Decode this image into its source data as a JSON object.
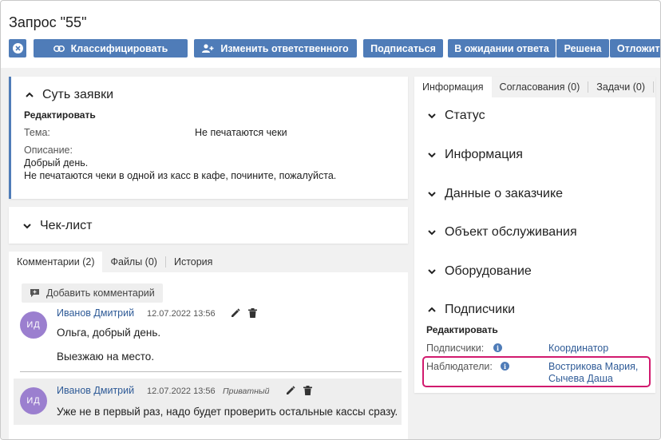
{
  "page": {
    "title": "Запрос \"55\""
  },
  "toolbar": {
    "classify_label": "Классифицировать",
    "change_owner_label": "Изменить ответственного",
    "subscribe_label": "Подписаться",
    "waiting_label": "В ожидании ответа",
    "resolved_label": "Решена",
    "postpone_label": "Отложить"
  },
  "summary": {
    "title": "Суть заявки",
    "edit_label": "Редактировать",
    "topic_label": "Тема:",
    "topic_value": "Не печатаются чеки",
    "description_label": "Описание:",
    "description_line1": "Добрый день.",
    "description_line2": "Не печатаются чеки в одной из касс в кафе, почините, пожалуйста."
  },
  "checklist": {
    "title": "Чек-лист"
  },
  "left_tabs": [
    {
      "label": "Комментарии (2)",
      "active": true
    },
    {
      "label": "Файлы (0)",
      "active": false
    },
    {
      "label": "История",
      "active": false
    }
  ],
  "comments": {
    "add_label": "Добавить комментарий",
    "items": [
      {
        "initials": "ИД",
        "author": "Иванов Дмитрий",
        "date": "12.07.2022 13:56",
        "private": "",
        "lines": [
          "Ольга, добрый день.",
          "Выезжаю на место."
        ]
      },
      {
        "initials": "ИД",
        "author": "Иванов Дмитрий",
        "date": "12.07.2022 13:56",
        "private": "Приватный",
        "lines": [
          "Уже не в первый раз, надо будет проверить остальные кассы сразу."
        ]
      }
    ]
  },
  "right_tabs": [
    {
      "label": "Информация",
      "active": true
    },
    {
      "label": "Согласования (0)",
      "active": false
    },
    {
      "label": "Задачи (0)",
      "active": false
    }
  ],
  "right_sections": [
    {
      "label": "Статус",
      "expanded": false
    },
    {
      "label": "Информация",
      "expanded": false
    },
    {
      "label": "Данные о заказчике",
      "expanded": false
    },
    {
      "label": "Объект обслуживания",
      "expanded": false
    },
    {
      "label": "Оборудование",
      "expanded": false
    },
    {
      "label": "Подписчики",
      "expanded": true
    }
  ],
  "subscribers": {
    "edit_label": "Редактировать",
    "subscribers_label": "Подписчики:",
    "subscribers_value": "Координатор",
    "observers_label": "Наблюдатели:",
    "observer_1": "Вострикова Мария,",
    "observer_2": "Сычева Даша"
  },
  "colors": {
    "primary": "#4f7cb8",
    "link": "#2f5b97",
    "avatar": "#9b7fcf",
    "highlight": "#d11a6e"
  }
}
